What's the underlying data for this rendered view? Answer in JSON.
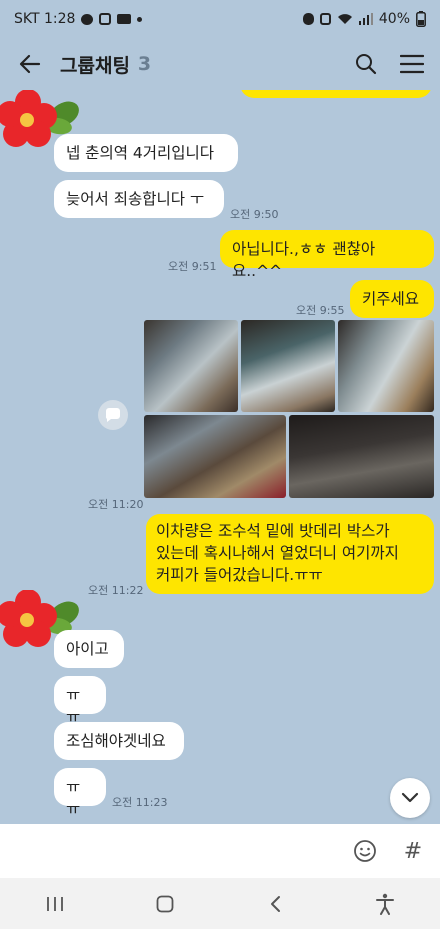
{
  "status_bar": {
    "carrier_time": "SKT 1:28",
    "battery": "40%"
  },
  "header": {
    "title": "그룹채팅",
    "member_count": "3"
  },
  "messages": [
    {
      "id": "m1",
      "direction": "in",
      "text": "넵 춘의역 4거리입니다"
    },
    {
      "id": "m2",
      "direction": "in",
      "text": "늦어서 죄송합니다 ㅜ",
      "time": "오전 9:50"
    },
    {
      "id": "m3",
      "direction": "out",
      "text": "아닙니다.,ㅎㅎ 괜찮아요..^^",
      "time": "오전 9:51"
    },
    {
      "id": "m4",
      "direction": "out",
      "text": "키주세요",
      "time": "오전 9:55"
    },
    {
      "id": "m5",
      "direction": "out",
      "type": "photos",
      "time": "오전 11:20"
    },
    {
      "id": "m6",
      "direction": "out",
      "text_lines": [
        "이차량은 조수석 밑에 밧데리 박스가",
        "있는데 혹시나해서 열었더니 여기까지",
        "커피가  들어갔습니다.ㅠㅠ"
      ],
      "time": "오전 11:22"
    },
    {
      "id": "m7",
      "direction": "in",
      "text": "아이고"
    },
    {
      "id": "m8",
      "direction": "in",
      "text": "ㅠㅠ"
    },
    {
      "id": "m9",
      "direction": "in",
      "text": "조심해야겟네요"
    },
    {
      "id": "m10",
      "direction": "in",
      "text": "ㅠㅠ",
      "time": "오전 11:23"
    }
  ],
  "icons": {
    "back": "arrow-left-icon",
    "search": "search-icon",
    "menu": "hamburger-menu-icon",
    "share": "share-icon",
    "scroll_down": "chevron-down-icon",
    "emoji": "emoji-icon",
    "hash": "hashtag-icon",
    "avatar": "red-flower-avatar"
  },
  "input": {
    "placeholder": "",
    "hash_label": "#"
  },
  "colors": {
    "chat_background": "#b2c7da",
    "outgoing_bubble": "#fee500",
    "incoming_bubble": "#ffffff"
  }
}
